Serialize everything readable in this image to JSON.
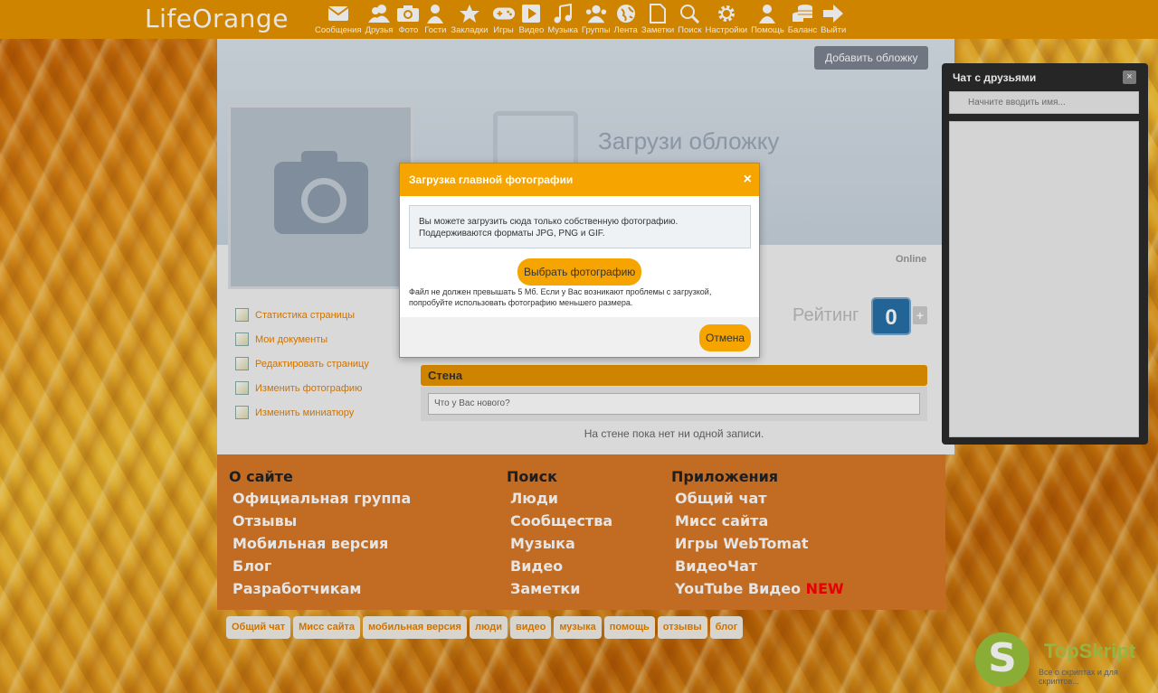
{
  "brand": {
    "logo": "LifeOrange"
  },
  "nav": [
    {
      "label": "Сообщения",
      "icon": "envelope-icon"
    },
    {
      "label": "Друзья",
      "icon": "friends-icon"
    },
    {
      "label": "Фото",
      "icon": "camera-icon"
    },
    {
      "label": "Гости",
      "icon": "person-icon"
    },
    {
      "label": "Закладки",
      "icon": "star-icon"
    },
    {
      "label": "Игры",
      "icon": "gamepad-icon"
    },
    {
      "label": "Видео",
      "icon": "play-icon"
    },
    {
      "label": "Музыка",
      "icon": "music-icon"
    },
    {
      "label": "Группы",
      "icon": "group-icon"
    },
    {
      "label": "Лента",
      "icon": "globe-icon"
    },
    {
      "label": "Заметки",
      "icon": "note-icon"
    },
    {
      "label": "Поиск",
      "icon": "search-icon"
    },
    {
      "label": "Настройки",
      "icon": "gear-icon"
    },
    {
      "label": "Помощь",
      "icon": "help-person-icon"
    },
    {
      "label": "Баланс",
      "icon": "coins-icon"
    },
    {
      "label": "Выйти",
      "icon": "arrow-right-icon"
    }
  ],
  "profile": {
    "add_cover": "Добавить обложку",
    "upload_cover": "Загрузи обложку",
    "status": "Online",
    "rating_label": "Рейтинг",
    "rating_value": "0",
    "rating_plus": "+"
  },
  "side_menu": [
    {
      "label": "Статистика страницы"
    },
    {
      "label": "Мои документы"
    },
    {
      "label": "Редактировать страницу"
    },
    {
      "label": "Изменить фотографию"
    },
    {
      "label": "Изменить миниатюру"
    }
  ],
  "wall": {
    "title": "Стена",
    "placeholder": "Что у Вас нового?",
    "empty": "На стене пока нет ни одной записи."
  },
  "footer": {
    "about": {
      "title": "О сайте",
      "links": [
        "Официальная группа",
        "Отзывы",
        "Мобильная версия",
        "Блог",
        "Разработчикам"
      ]
    },
    "search": {
      "title": "Поиск",
      "links": [
        "Люди",
        "Сообщества",
        "Музыка",
        "Видео",
        "Заметки"
      ]
    },
    "apps": {
      "title": "Приложения",
      "links": [
        "Общий чат",
        "Мисс сайта",
        "Игры WebTomat",
        "ВидеоЧат",
        "YouTube Видео"
      ],
      "new_badge": "NEW"
    }
  },
  "tags": [
    "Общий чат",
    "Мисс сайта",
    "мобильная версия",
    "люди",
    "видео",
    "музыка",
    "помощь",
    "отзывы",
    "блог"
  ],
  "chat": {
    "title": "Чат с друзьями",
    "close": "×",
    "placeholder": "Начните вводить имя..."
  },
  "modal": {
    "title": "Загрузка главной фотографии",
    "close": "×",
    "info_line1": "Вы можете загрузить сюда только собственную фотографию.",
    "info_line2": "Поддерживаются форматы JPG, PNG и GIF.",
    "choose_button": "Выбрать фотографию",
    "note": "Файл не должен превышать 5 Мб. Если у Вас возникают проблемы с загрузкой, попробуйте использовать фотографию меньшего размера.",
    "cancel_button": "Отмена"
  },
  "watermark": {
    "logo_letter": "S",
    "title": "TopSkript",
    "subtitle": "Все о скриптах и для скриптов..."
  }
}
